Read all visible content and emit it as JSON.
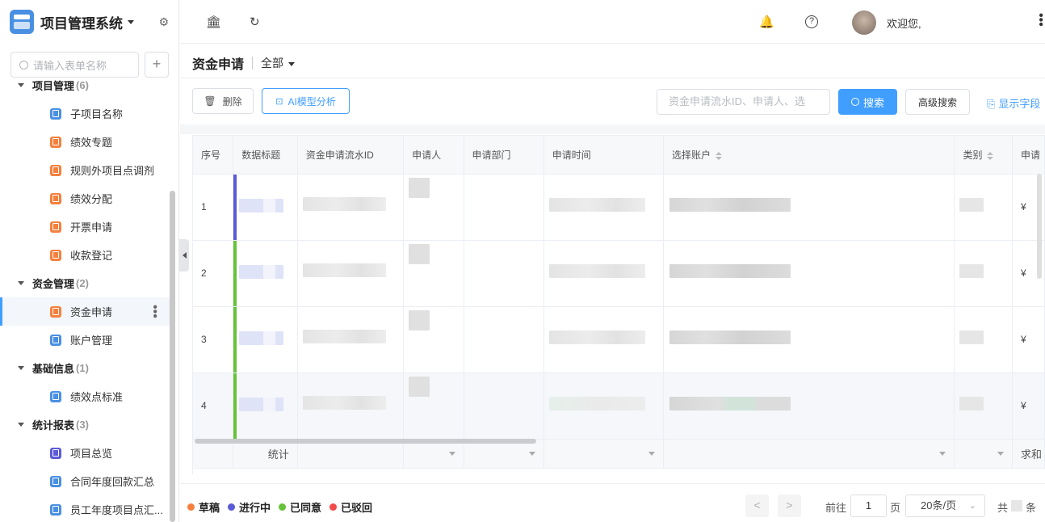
{
  "app": {
    "title": "项目管理系统"
  },
  "sidebar": {
    "search_placeholder": "请输入表单名称",
    "add_label": "+",
    "groups": [
      {
        "name": "项目管理",
        "count": "(6)",
        "items": [
          {
            "label": "子项目名称",
            "color": "#4a90e2"
          },
          {
            "label": "绩效专题",
            "color": "#f5803e"
          },
          {
            "label": "规则外项目点调剂",
            "color": "#f5803e"
          },
          {
            "label": "绩效分配",
            "color": "#f5803e"
          },
          {
            "label": "开票申请",
            "color": "#f5803e"
          },
          {
            "label": "收款登记",
            "color": "#f5803e"
          }
        ]
      },
      {
        "name": "资金管理",
        "count": "(2)",
        "items": [
          {
            "label": "资金申请",
            "color": "#f5803e",
            "active": true
          },
          {
            "label": "账户管理",
            "color": "#4a90e2"
          }
        ]
      },
      {
        "name": "基础信息",
        "count": "(1)",
        "items": [
          {
            "label": "绩效点标准",
            "color": "#4a90e2"
          }
        ]
      },
      {
        "name": "统计报表",
        "count": "(3)",
        "items": [
          {
            "label": "项目总览",
            "color": "#5b5bd6"
          },
          {
            "label": "合同年度回款汇总",
            "color": "#4a90e2"
          },
          {
            "label": "员工年度项目点汇...",
            "color": "#4a90e2"
          }
        ]
      }
    ]
  },
  "topbar": {
    "welcome": "欢迎您,"
  },
  "page": {
    "title": "资金申请",
    "filter": "全部"
  },
  "toolbar": {
    "delete_label": "删除",
    "ai_label": "AI模型分析",
    "search_placeholder": "资金申请流水ID、申请人、选",
    "search_label": "搜索",
    "advanced_label": "高级搜索",
    "show_fields_label": "显示字段"
  },
  "table": {
    "columns": [
      "序号",
      "数据标题",
      "资金申请流水ID",
      "申请人",
      "申请部门",
      "申请时间",
      "选择账户",
      "类别",
      "申请"
    ],
    "rows": [
      {
        "index": "1",
        "status_color": "#5b5bd6",
        "currency": "¥"
      },
      {
        "index": "2",
        "status_color": "#67c23a",
        "currency": "¥"
      },
      {
        "index": "3",
        "status_color": "#67c23a",
        "currency": "¥"
      },
      {
        "index": "4",
        "status_color": "#67c23a",
        "currency": "¥"
      }
    ],
    "summary_label": "统计",
    "summary_last": "求和"
  },
  "legend": [
    {
      "label": "草稿",
      "color": "#f5803e"
    },
    {
      "label": "进行中",
      "color": "#5b5bd6"
    },
    {
      "label": "已同意",
      "color": "#67c23a"
    },
    {
      "label": "已驳回",
      "color": "#f04a4a"
    }
  ],
  "pagination": {
    "prev": "<",
    "next": ">",
    "goto_label": "前往",
    "page": "1",
    "page_unit": "页",
    "page_size": "20条/页",
    "total_prefix": "共",
    "total_suffix": "条"
  }
}
